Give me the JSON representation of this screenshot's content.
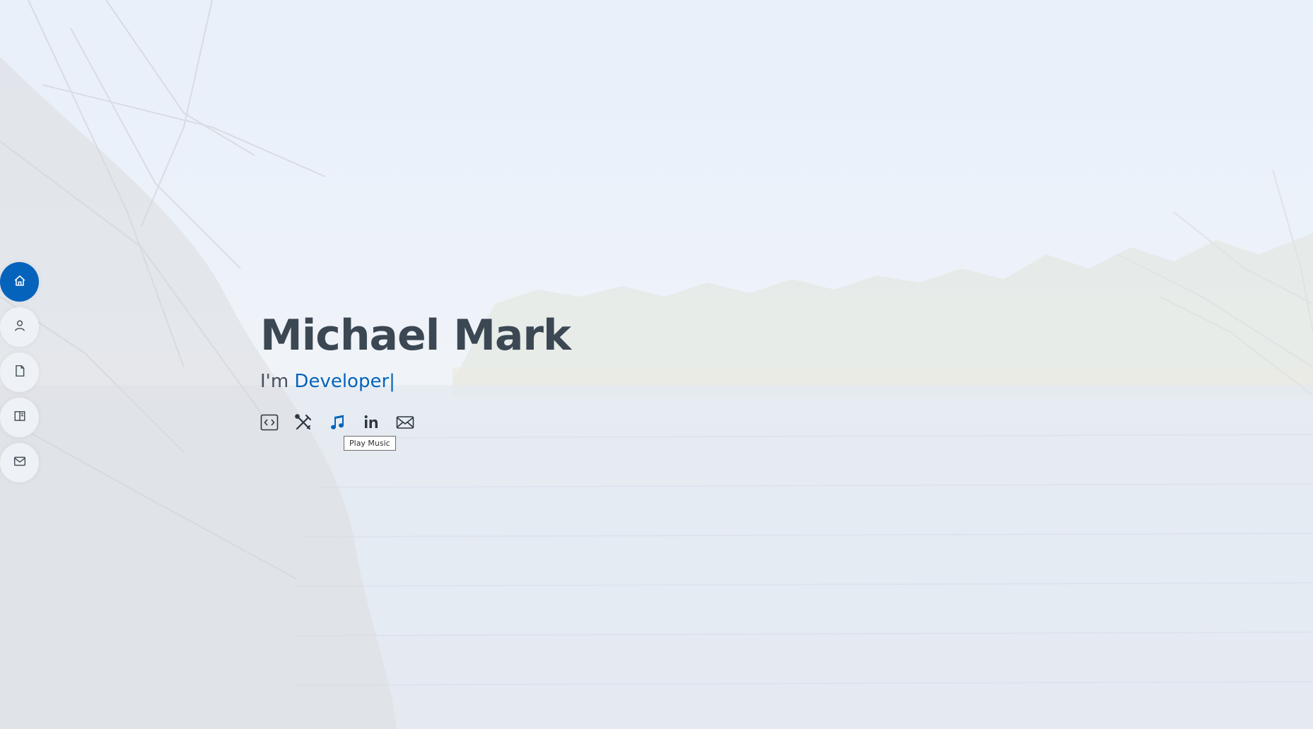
{
  "hero": {
    "name": "Michael Mark",
    "prefix": "I'm",
    "typed_text": "Developer",
    "cursor": "|"
  },
  "side_nav": {
    "items": [
      {
        "icon": "home-icon",
        "active": true
      },
      {
        "icon": "user-icon",
        "active": false
      },
      {
        "icon": "file-icon",
        "active": false
      },
      {
        "icon": "book-icon",
        "active": false
      },
      {
        "icon": "envelope-icon",
        "active": false
      }
    ]
  },
  "social": {
    "items": [
      {
        "icon": "code-icon"
      },
      {
        "icon": "tools-icon"
      },
      {
        "icon": "music-icon"
      },
      {
        "icon": "linkedin-icon"
      },
      {
        "icon": "envelope-icon"
      }
    ]
  },
  "tooltip": {
    "text": "Play Music"
  },
  "colors": {
    "accent": "#0563bb",
    "heading": "#3b4753",
    "nav_bg": "#eef2f6"
  }
}
